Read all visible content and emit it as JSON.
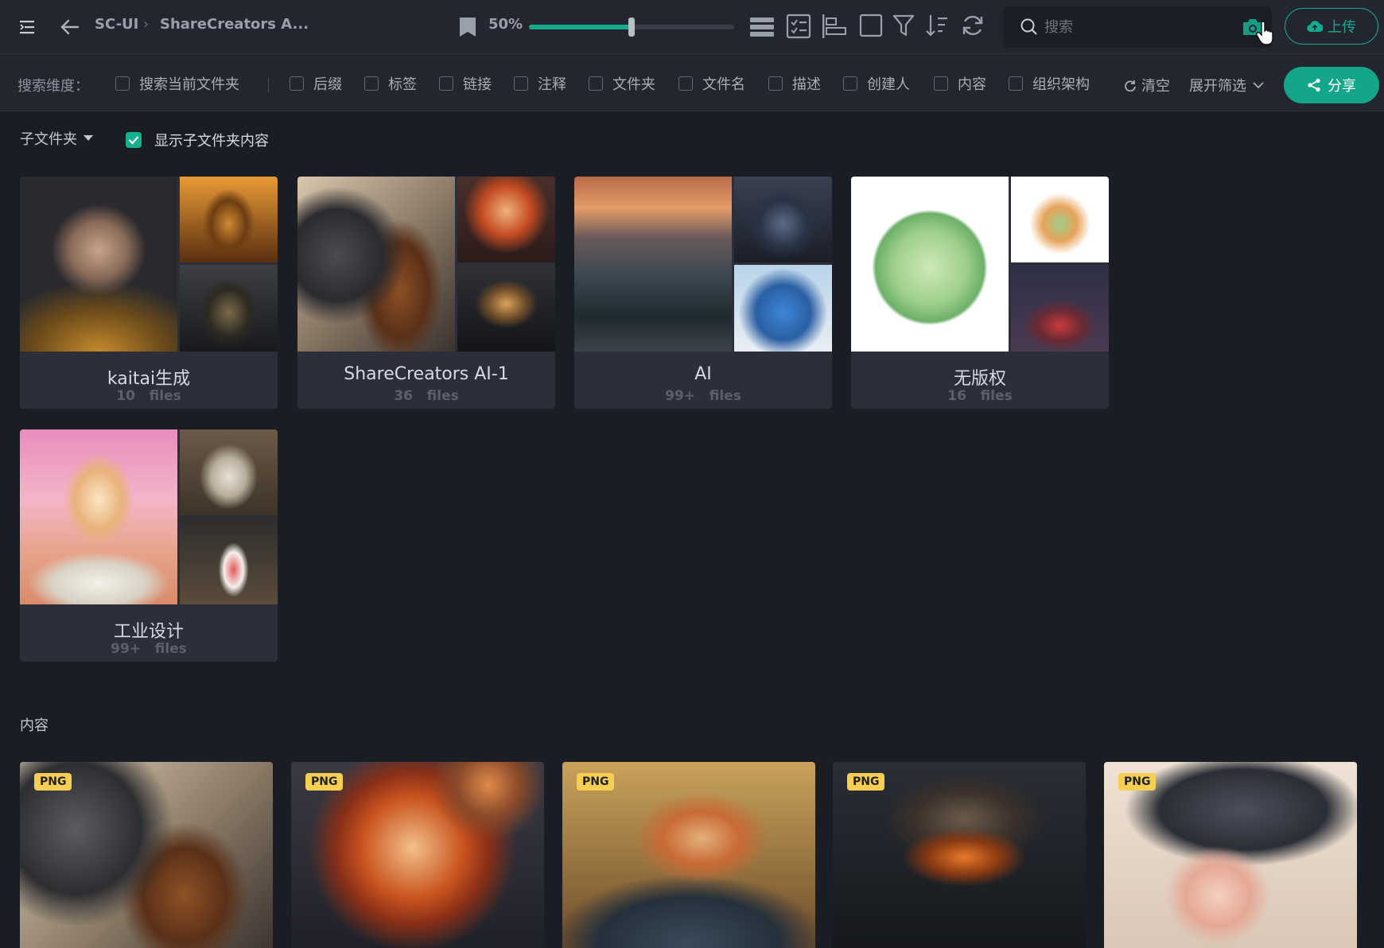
{
  "colors": {
    "accent": "#17a88e",
    "badge": "#f6cf52",
    "bg": "#1b1d24",
    "bar": "#23262f"
  },
  "toolbar": {
    "breadcrumb": [
      "SC-UI",
      "ShareCreators A..."
    ],
    "zoom_percent": "50%",
    "zoom_level": 0.5,
    "search_placeholder": "搜索",
    "upload_label": "上传",
    "icons": [
      "menu-collapse-icon",
      "back-arrow-icon",
      "bookmark-icon",
      "list-view-icon",
      "checklist-icon",
      "align-icon",
      "square-select-icon",
      "filter-icon",
      "sort-icon",
      "refresh-icon",
      "search-icon",
      "camera-search-icon",
      "upload-cloud-icon"
    ]
  },
  "filter": {
    "label": "搜索维度：",
    "options": [
      "搜索当前文件夹",
      "后缀",
      "标签",
      "链接",
      "注释",
      "文件夹",
      "文件名",
      "描述",
      "创建人",
      "内容",
      "组织架构"
    ],
    "clear_label": "清空",
    "expand_label": "展开筛选",
    "share_label": "分享"
  },
  "subfolders": {
    "dropdown_label": "子文件夹",
    "show_content_label": "显示子文件夹内容",
    "show_content_checked": true,
    "folders": [
      {
        "name": "kaitai生成",
        "count": "10",
        "unit": "files"
      },
      {
        "name": "ShareCreators AI-1",
        "count": "36",
        "unit": "files"
      },
      {
        "name": "AI",
        "count": "99+",
        "unit": "files"
      },
      {
        "name": "无版权",
        "count": "16",
        "unit": "files"
      },
      {
        "name": "工业设计",
        "count": "99+",
        "unit": "files"
      }
    ]
  },
  "content": {
    "label": "内容",
    "items": [
      {
        "badge": "PNG"
      },
      {
        "badge": "PNG"
      },
      {
        "badge": "PNG"
      },
      {
        "badge": "PNG"
      },
      {
        "badge": "PNG"
      }
    ]
  }
}
